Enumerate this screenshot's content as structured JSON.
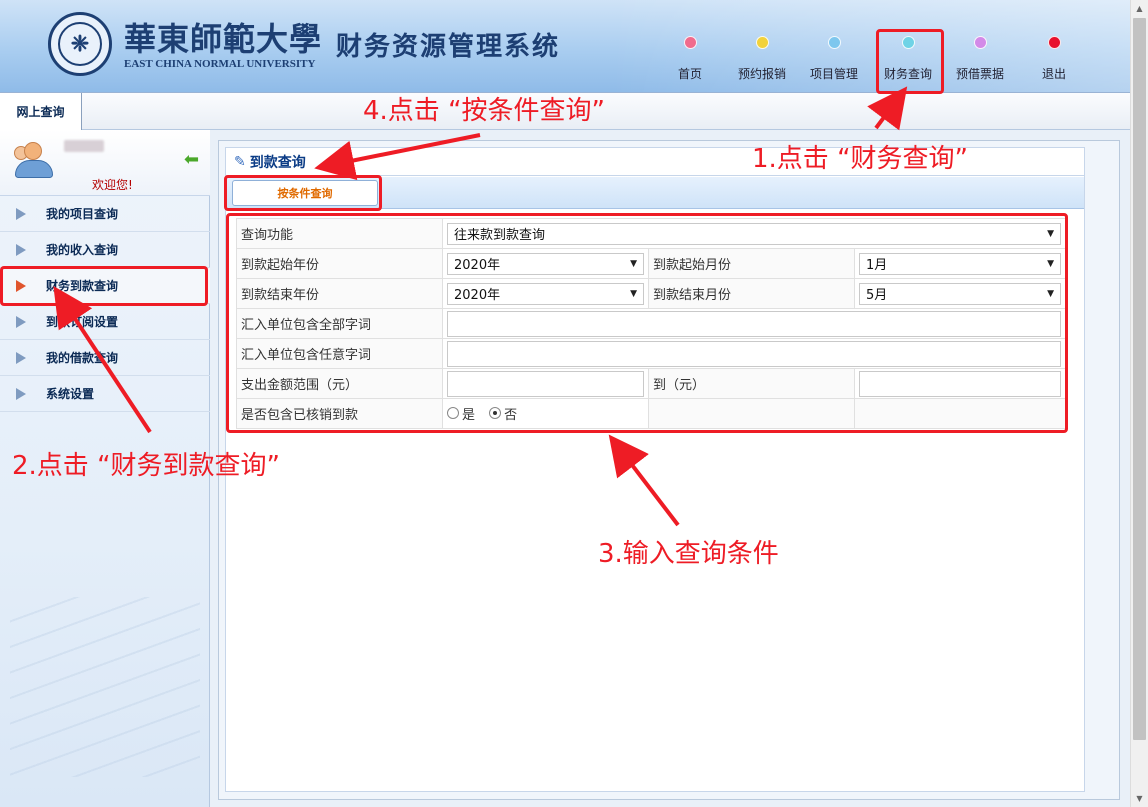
{
  "header": {
    "logo_cn": "華東師範大學",
    "logo_en": "EAST CHINA NORMAL UNIVERSITY",
    "system_title": "财务资源管理系统",
    "nav": [
      {
        "label": "首页",
        "dot_color": "#f06b8d"
      },
      {
        "label": "预约报销",
        "dot_color": "#f2d23b"
      },
      {
        "label": "项目管理",
        "dot_color": "#7ec7ee"
      },
      {
        "label": "财务查询",
        "dot_color": "#6fd3e6"
      },
      {
        "label": "预借票据",
        "dot_color": "#d38ae8"
      },
      {
        "label": "退出",
        "dot_color": "#e8112d"
      }
    ]
  },
  "tabbar": {
    "online_label": "网上查询"
  },
  "sidebar": {
    "welcome": "欢迎您!",
    "items": [
      {
        "label": "我的项目查询"
      },
      {
        "label": "我的收入查询"
      },
      {
        "label": "财务到款查询"
      },
      {
        "label": "到款订阅设置"
      },
      {
        "label": "我的借款查询"
      },
      {
        "label": "系统设置"
      }
    ],
    "active_index": 2
  },
  "panel": {
    "title": "到款查询",
    "subtab": "按条件查询",
    "form": {
      "function_label": "查询功能",
      "function_value": "往来款到款查询",
      "start_year_label": "到款起始年份",
      "start_year_value": "2020年",
      "start_month_label": "到款起始月份",
      "start_month_value": "1月",
      "end_year_label": "到款结束年份",
      "end_year_value": "2020年",
      "end_month_label": "到款结束月份",
      "end_month_value": "5月",
      "all_words_label": "汇入单位包含全部字词",
      "any_words_label": "汇入单位包含任意字词",
      "amount_label": "支出金额范围（元）",
      "amount_to_label": "到（元）",
      "verified_label": "是否包含已核销到款",
      "radio_yes": "是",
      "radio_no": "否",
      "radio_selected": "否"
    }
  },
  "annotations": {
    "step1": "1.点击 “财务查询”",
    "step2": "2.点击 “财务到款查询”",
    "step3": "3.输入查询条件",
    "step4": "4.点击 “按条件查询”",
    "color": "#ee1c25"
  }
}
